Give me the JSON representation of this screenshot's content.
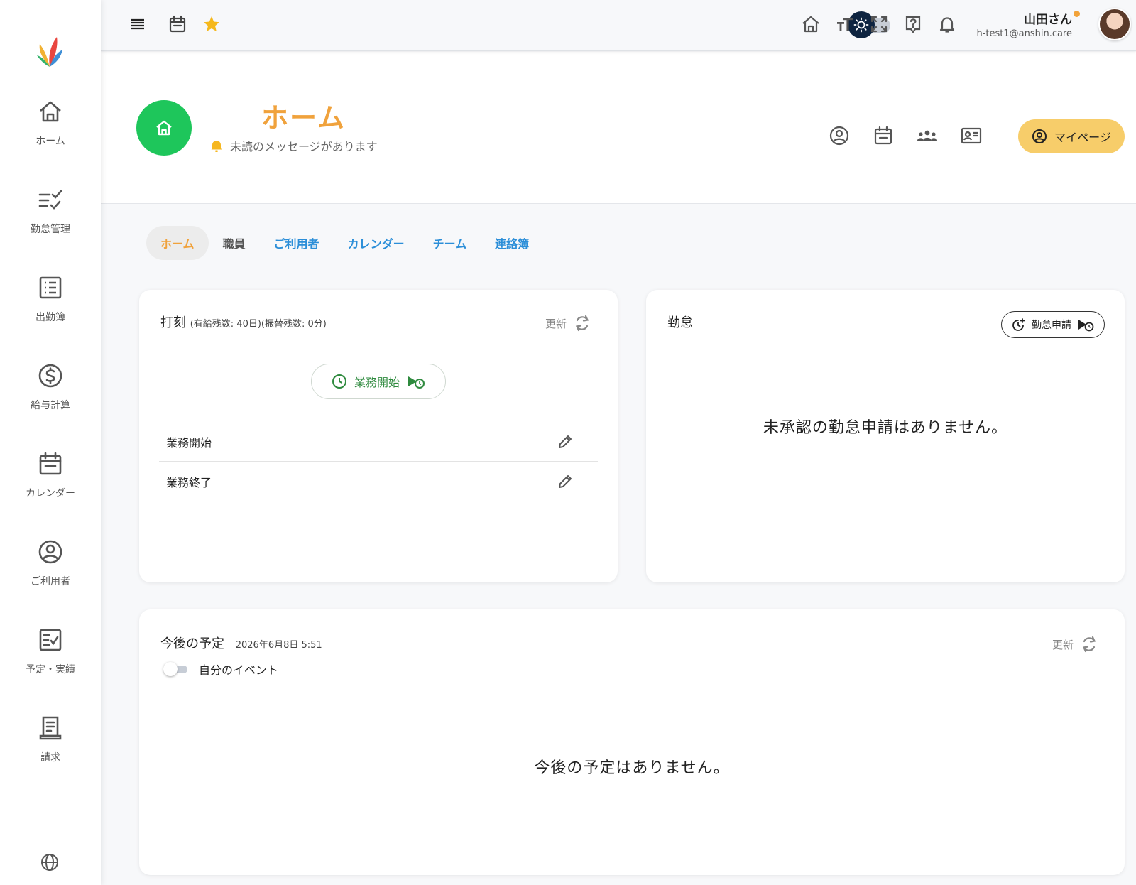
{
  "colors": {
    "accent": "#f0a23c",
    "home_green": "#1ec65b",
    "link_blue": "#2b8ed8",
    "mypage_bg": "#f7cd6a",
    "start_green": "#2e8a3e"
  },
  "sidebar": {
    "items": [
      {
        "label": "ホーム",
        "icon": "home-icon"
      },
      {
        "label": "勤怠管理",
        "icon": "checklist-icon"
      },
      {
        "label": "出勤簿",
        "icon": "list-icon"
      },
      {
        "label": "給与計算",
        "icon": "dollar-icon"
      },
      {
        "label": "カレンダー",
        "icon": "calendar-icon"
      },
      {
        "label": "ご利用者",
        "icon": "user-circle-icon"
      },
      {
        "label": "予定・実績",
        "icon": "schedule-check-icon"
      },
      {
        "label": "請求",
        "icon": "receipt-icon"
      }
    ]
  },
  "topbar": {
    "user_name": "山田さん",
    "user_email": "h-test1@anshin.care"
  },
  "header": {
    "title": "ホーム",
    "message": "未読のメッセージがあります",
    "mypage_label": "マイページ"
  },
  "tabs": [
    {
      "label": "ホーム"
    },
    {
      "label": "職員"
    },
    {
      "label": "ご利用者"
    },
    {
      "label": "カレンダー"
    },
    {
      "label": "チーム"
    },
    {
      "label": "連絡簿"
    }
  ],
  "punch_card": {
    "title": "打刻",
    "subtitle": "(有給残数: 40日)(振替残数: 0分)",
    "refresh_label": "更新",
    "start_button": "業務開始",
    "rows": [
      {
        "label": "業務開始"
      },
      {
        "label": "業務終了"
      }
    ]
  },
  "attendance_card": {
    "title": "勤怠",
    "apply_button": "勤怠申請",
    "empty_message": "未承認の勤怠申請はありません。"
  },
  "schedule_card": {
    "title": "今後の予定",
    "datetime": "2026年6月8日 5:51",
    "refresh_label": "更新",
    "toggle_label": "自分のイベント",
    "empty_message": "今後の予定はありません。"
  }
}
